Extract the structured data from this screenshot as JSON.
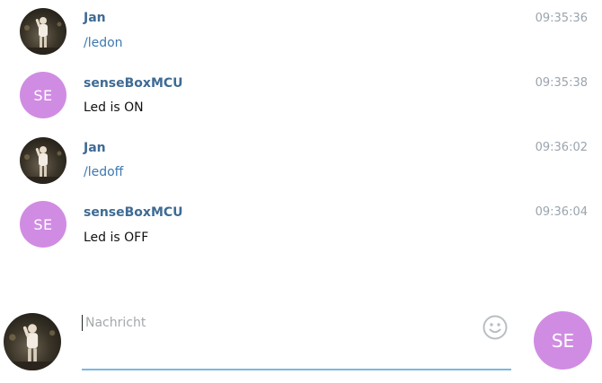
{
  "messages": [
    {
      "sender": "Jan",
      "text": "/ledon",
      "time": "09:35:36",
      "avatar": "photo",
      "is_command": true
    },
    {
      "sender": "senseBoxMCU",
      "text": "Led is ON",
      "time": "09:35:38",
      "avatar": "initials",
      "initials": "SE",
      "is_command": false
    },
    {
      "sender": "Jan",
      "text": "/ledoff",
      "time": "09:36:02",
      "avatar": "photo",
      "is_command": true
    },
    {
      "sender": "senseBoxMCU",
      "text": "Led is OFF",
      "time": "09:36:04",
      "avatar": "initials",
      "initials": "SE",
      "is_command": false
    }
  ],
  "composer": {
    "placeholder": "Nachricht",
    "value": "",
    "emoji_icon": "smiley-icon",
    "send_as_initials": "SE"
  },
  "colors": {
    "accent": "#7ab7e4",
    "bot_avatar": "#d08ce3",
    "sender_name": "#3e6b94",
    "command_link": "#3e78b0",
    "timestamp": "#9aa4ad"
  }
}
